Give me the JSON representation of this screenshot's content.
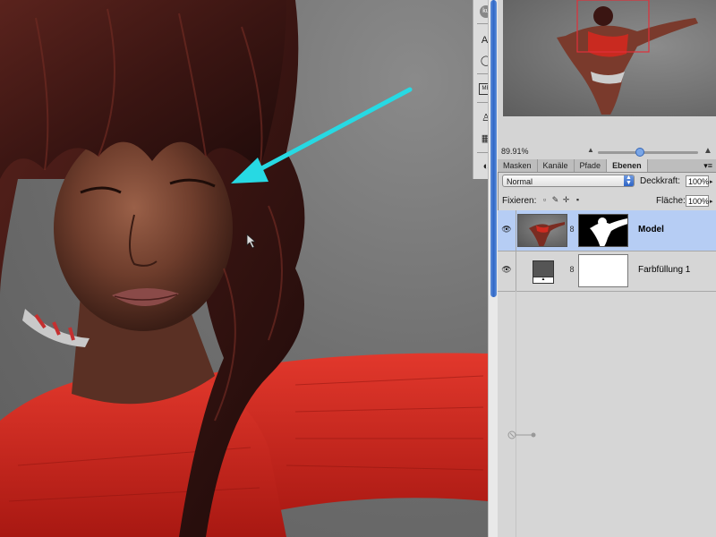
{
  "navigator": {
    "zoom": "89.91%",
    "zoom_slider_fraction": 0.42
  },
  "tabs": [
    {
      "label": "Masken",
      "active": false
    },
    {
      "label": "Kanäle",
      "active": false
    },
    {
      "label": "Pfade",
      "active": false
    },
    {
      "label": "Ebenen",
      "active": true
    }
  ],
  "layers_panel": {
    "blend_mode": "Normal",
    "opacity_label": "Deckkraft:",
    "opacity_value": "100%",
    "lock_label": "Fixieren:",
    "fill_label": "Fläche:",
    "fill_value": "100%",
    "layers": [
      {
        "name": "Model",
        "selected": true,
        "visible": true,
        "has_mask": true
      },
      {
        "name": "Farbfüllung 1",
        "selected": false,
        "visible": true,
        "has_mask": true
      }
    ]
  },
  "toolstrip": {
    "icons": [
      "ku-badge-icon",
      "text-tool-icon",
      "brush-preset-icon",
      "mb-icon",
      "puppet-icon",
      "filmstrip-icon",
      "contrast-icon"
    ]
  },
  "colors": {
    "annotation_arrow": "#27d9e3",
    "selection": "#b6cdf4",
    "scrollbar_accent": "#2f66c7",
    "nav_frame": "#e0303a"
  }
}
